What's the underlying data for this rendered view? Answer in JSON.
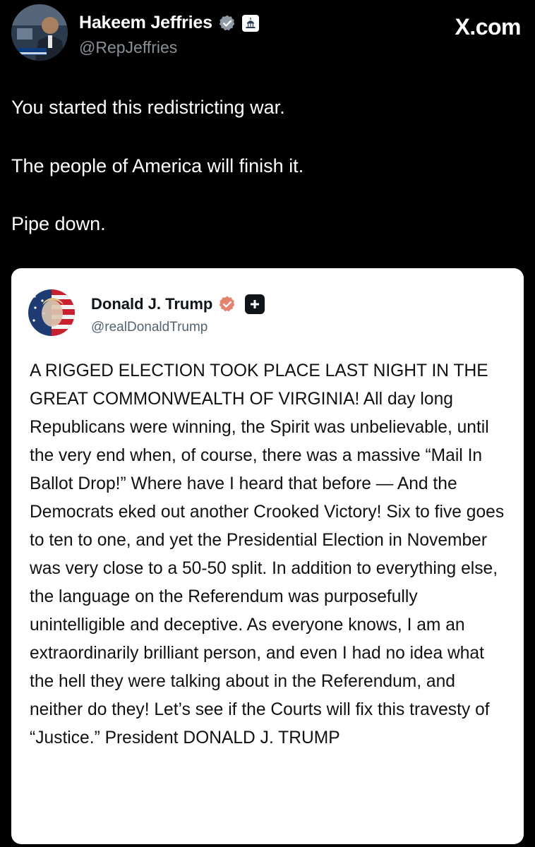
{
  "watermark": "X.com",
  "post": {
    "author": {
      "name": "Hakeem Jeffries",
      "handle": "@RepJeffries"
    },
    "lines": [
      "You started this redistricting war.",
      "The people of America will finish it.",
      "Pipe down."
    ]
  },
  "quoted": {
    "author": {
      "name": "Donald J. Trump",
      "handle": "@realDonaldTrump"
    },
    "text": "A RIGGED ELECTION TOOK PLACE LAST NIGHT IN THE GREAT COMMONWEALTH OF VIRGINIA! All day long Republicans were winning, the Spirit was unbelievable, until the very end when, of course, there was a massive “Mail In Ballot Drop!” Where have I heard that before — And the Democrats eked out another Crooked Victory! Six to five goes to ten to one, and yet the Presidential Election in November was very close to a 50-50 split. In addition to everything else, the language on the Referendum was purposefully unintelligible and deceptive. As everyone knows, I am an extraordinarily brilliant person, and even I had no idea what the hell they were talking about in the Referendum, and neither do they! Let’s see if the Courts will fix this travesty of “Justice.” President DONALD J. TRUMP"
  },
  "colors": {
    "background": "#000000",
    "verified_blue": "#1d9bf0",
    "truth_badge": "#e5826e",
    "handle_gray": "#8b9096"
  },
  "icons": {
    "verified": "verified-badge-icon",
    "government": "capitol-building-icon",
    "quoted_verified": "verified-badge-icon",
    "quoted_plus": "plus-icon"
  }
}
